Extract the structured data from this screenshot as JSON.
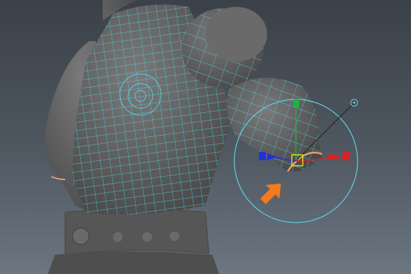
{
  "viewport": {
    "view": "perspective-3d-viewport",
    "background_top": "#3b4149",
    "background_bottom": "#6b7681"
  },
  "model": {
    "mesh_color": "#5c5c5c",
    "wireframe_color": "#4fd8ea",
    "selected_edge_color": "#f0a060"
  },
  "manipulator": {
    "ring_color": "#5fd0e8",
    "x_axis_color": "#e02020",
    "y_axis_color": "#20b040",
    "z_axis_color": "#2030e0",
    "center_color": "#e0e020"
  },
  "annotation": {
    "icon": "orange-pointer-arrow-icon",
    "color": "#f57a1e"
  }
}
